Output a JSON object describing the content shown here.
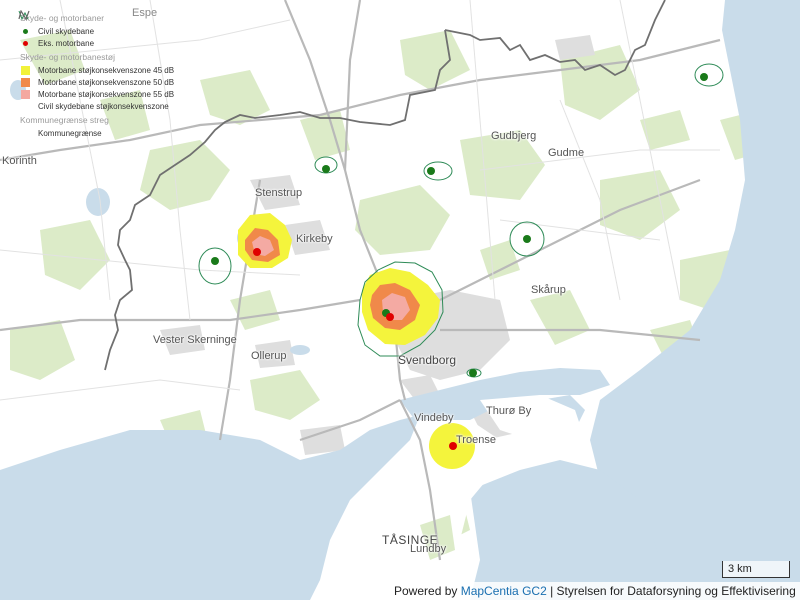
{
  "legend": {
    "group1_title": "Skyde- og motorbaner",
    "group1_items": [
      {
        "label": "Civil skydebane",
        "color": "#1a7a1a",
        "icon": "green-dot"
      },
      {
        "label": "Eks. motorbane",
        "color": "#e00000",
        "icon": "red-dot"
      }
    ],
    "group2_title": "Skyde- og motorbanestøj",
    "group2_items": [
      {
        "label": "Motorbane støjkonsekvenszone 45 dB",
        "color": "#f2f23a",
        "icon": "yellow-square"
      },
      {
        "label": "Motorbane støjkonsekvenszone 50 dB",
        "color": "#f08a4b",
        "icon": "orange-square"
      },
      {
        "label": "Motorbane støjkonsekvenszone 55 dB",
        "color": "#f4a8a0",
        "icon": "pink-square"
      },
      {
        "label": "Civil skydebane støjkonsekvenszone",
        "color": "#2e8b57",
        "icon": "green-outline"
      }
    ],
    "group3_title": "Kommunegrænse streg",
    "group3_items": [
      {
        "label": "Kommunegrænse",
        "color": "#666666",
        "icon": "boundary-line"
      }
    ]
  },
  "places": {
    "espe": "Espe",
    "korinth": "Korinth",
    "stenstrup": "Stenstrup",
    "kirkeby": "Kirkeby",
    "gudbjerg": "Gudbjerg",
    "gudme": "Gudme",
    "skarup": "Skårup",
    "vester_skerninge": "Vester Skerninge",
    "ollerup": "Ollerup",
    "svendborg": "Svendborg",
    "thuro_by": "Thurø By",
    "vindeby": "Vindeby",
    "troense": "Troense",
    "tasinge": "TÅSINGE",
    "lundby": "Lundby"
  },
  "scale": {
    "label": "3 km"
  },
  "attribution": {
    "prefix": "Powered by ",
    "link": "MapCentia GC2",
    "suffix": " | Styrelsen for Dataforsyning og Effektivisering"
  },
  "colors": {
    "water": "#c9dcea",
    "land": "#ffffff",
    "forest": "#dcebc8",
    "urban": "#d9d9d9",
    "road": "#b8b8b8",
    "boundary": "#707070",
    "civil_range": "#1a7a1a",
    "motor_track": "#e00000"
  }
}
